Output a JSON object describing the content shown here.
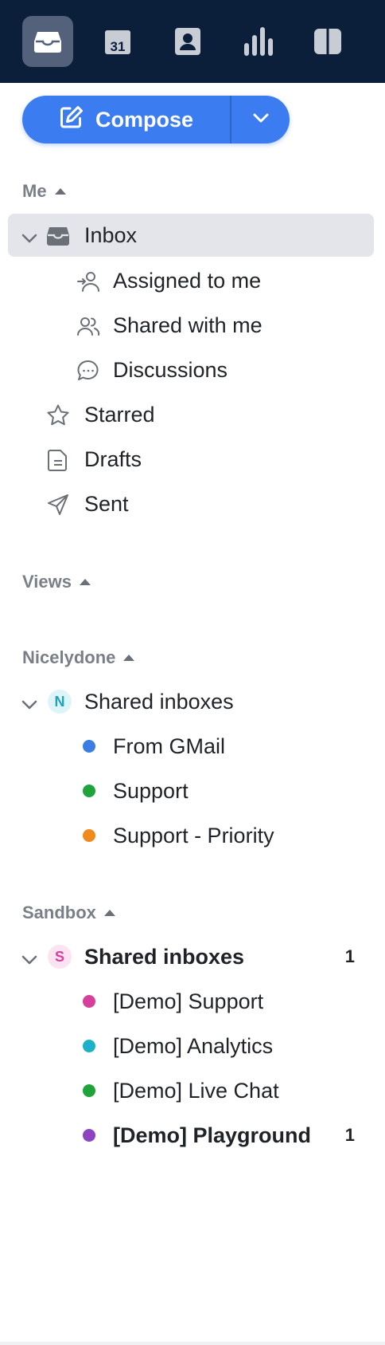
{
  "topbar": {
    "icons": [
      "inbox-tray-icon",
      "calendar-icon",
      "contacts-icon",
      "analytics-icon",
      "split-view-icon"
    ],
    "calendar_day": "31",
    "active": "inbox-tray-icon"
  },
  "compose": {
    "label": "Compose"
  },
  "sections": {
    "me": "Me",
    "views": "Views",
    "nicelydone": "Nicelydone",
    "sandbox": "Sandbox"
  },
  "me_items": {
    "inbox": "Inbox",
    "assigned": "Assigned to me",
    "shared": "Shared with me",
    "discussions": "Discussions",
    "starred": "Starred",
    "drafts": "Drafts",
    "sent": "Sent"
  },
  "nicelydone": {
    "avatar": "N",
    "group_label": "Shared inboxes",
    "inboxes": [
      {
        "label": "From GMail",
        "color": "#3b7de3"
      },
      {
        "label": "Support",
        "color": "#1fa33a"
      },
      {
        "label": "Support - Priority",
        "color": "#f08a1c"
      }
    ]
  },
  "sandbox": {
    "avatar": "S",
    "group_label": "Shared inboxes",
    "group_count": "1",
    "inboxes": [
      {
        "label": "[Demo] Support",
        "color": "#d63f9a",
        "count": ""
      },
      {
        "label": "[Demo] Analytics",
        "color": "#1fb0c9",
        "count": ""
      },
      {
        "label": "[Demo] Live Chat",
        "color": "#1fa33a",
        "count": ""
      },
      {
        "label": "[Demo] Playground",
        "color": "#8e44c0",
        "count": "1"
      }
    ]
  },
  "colors": {
    "topbar_bg": "#0b1f3a",
    "accent": "#3b7df0",
    "selected_bg": "#e3e5ea"
  }
}
